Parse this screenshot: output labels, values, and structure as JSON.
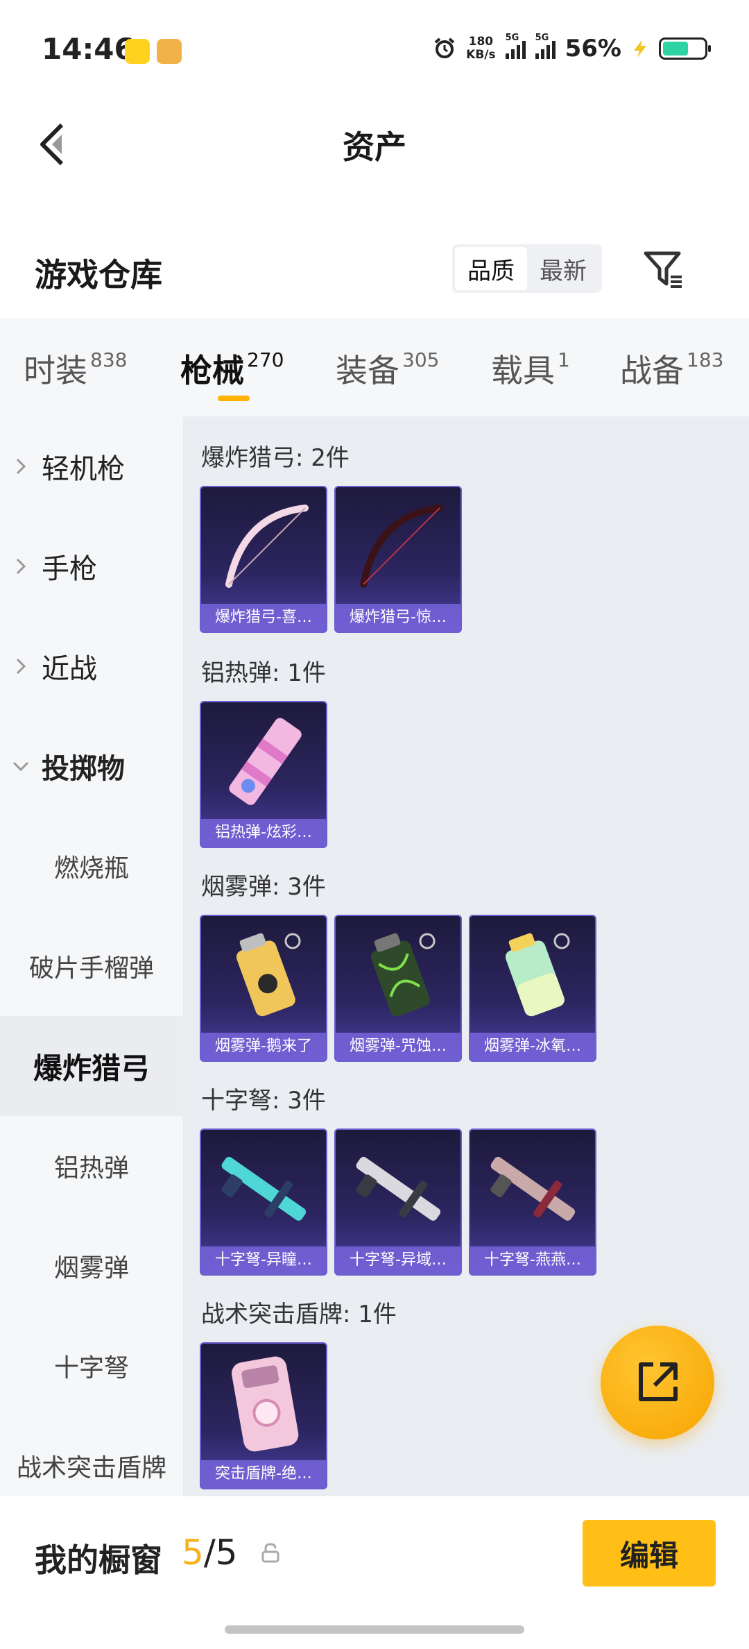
{
  "status_bar": {
    "time": "14:46",
    "net_speed_value": "180",
    "net_speed_unit": "KB/s",
    "signal1_tag": "5G",
    "signal2_tag": "5G",
    "battery_percent": "56%"
  },
  "header": {
    "title": "资产"
  },
  "warehouse": {
    "title": "游戏仓库",
    "sort_options": [
      "品质",
      "最新"
    ],
    "sort_selected": "品质"
  },
  "tabs": [
    {
      "label": "时装",
      "count": "838"
    },
    {
      "label": "枪械",
      "count": "270",
      "active": true
    },
    {
      "label": "装备",
      "count": "305"
    },
    {
      "label": "载具",
      "count": "1"
    },
    {
      "label": "战备",
      "count": "183"
    }
  ],
  "sidebar": {
    "items": [
      {
        "label": "轻机枪"
      },
      {
        "label": "手枪"
      },
      {
        "label": "近战"
      },
      {
        "label": "投掷物",
        "expanded": true
      },
      {
        "label": "燃烧瓶"
      },
      {
        "label": "破片手榴弹"
      },
      {
        "label": "爆炸猎弓",
        "selected": true
      },
      {
        "label": "铝热弹"
      },
      {
        "label": "烟雾弹"
      },
      {
        "label": "十字弩"
      },
      {
        "label": "战术突击盾牌"
      }
    ]
  },
  "groups": [
    {
      "title": "爆炸猎弓: 2件",
      "items": [
        "爆炸猎弓-喜…",
        "爆炸猎弓-惊…"
      ]
    },
    {
      "title": "铝热弹: 1件",
      "items": [
        "铝热弹-炫彩…"
      ]
    },
    {
      "title": "烟雾弹: 3件",
      "items": [
        "烟雾弹-鹅来了",
        "烟雾弹-咒蚀…",
        "烟雾弹-冰氧…"
      ]
    },
    {
      "title": "十字弩: 3件",
      "items": [
        "十字弩-异瞳…",
        "十字弩-异域…",
        "十字弩-燕燕…"
      ]
    },
    {
      "title": "战术突击盾牌: 1件",
      "items": [
        "突击盾牌-绝…"
      ]
    }
  ],
  "bottom_bar": {
    "showcase_label": "我的橱窗",
    "showcase_current": "5",
    "showcase_sep": "/",
    "showcase_total": "5",
    "edit_label": "编辑"
  },
  "colors": {
    "accent": "#ffbf16",
    "card_bg": "#2c2560",
    "card_caption": "#7864dc"
  }
}
